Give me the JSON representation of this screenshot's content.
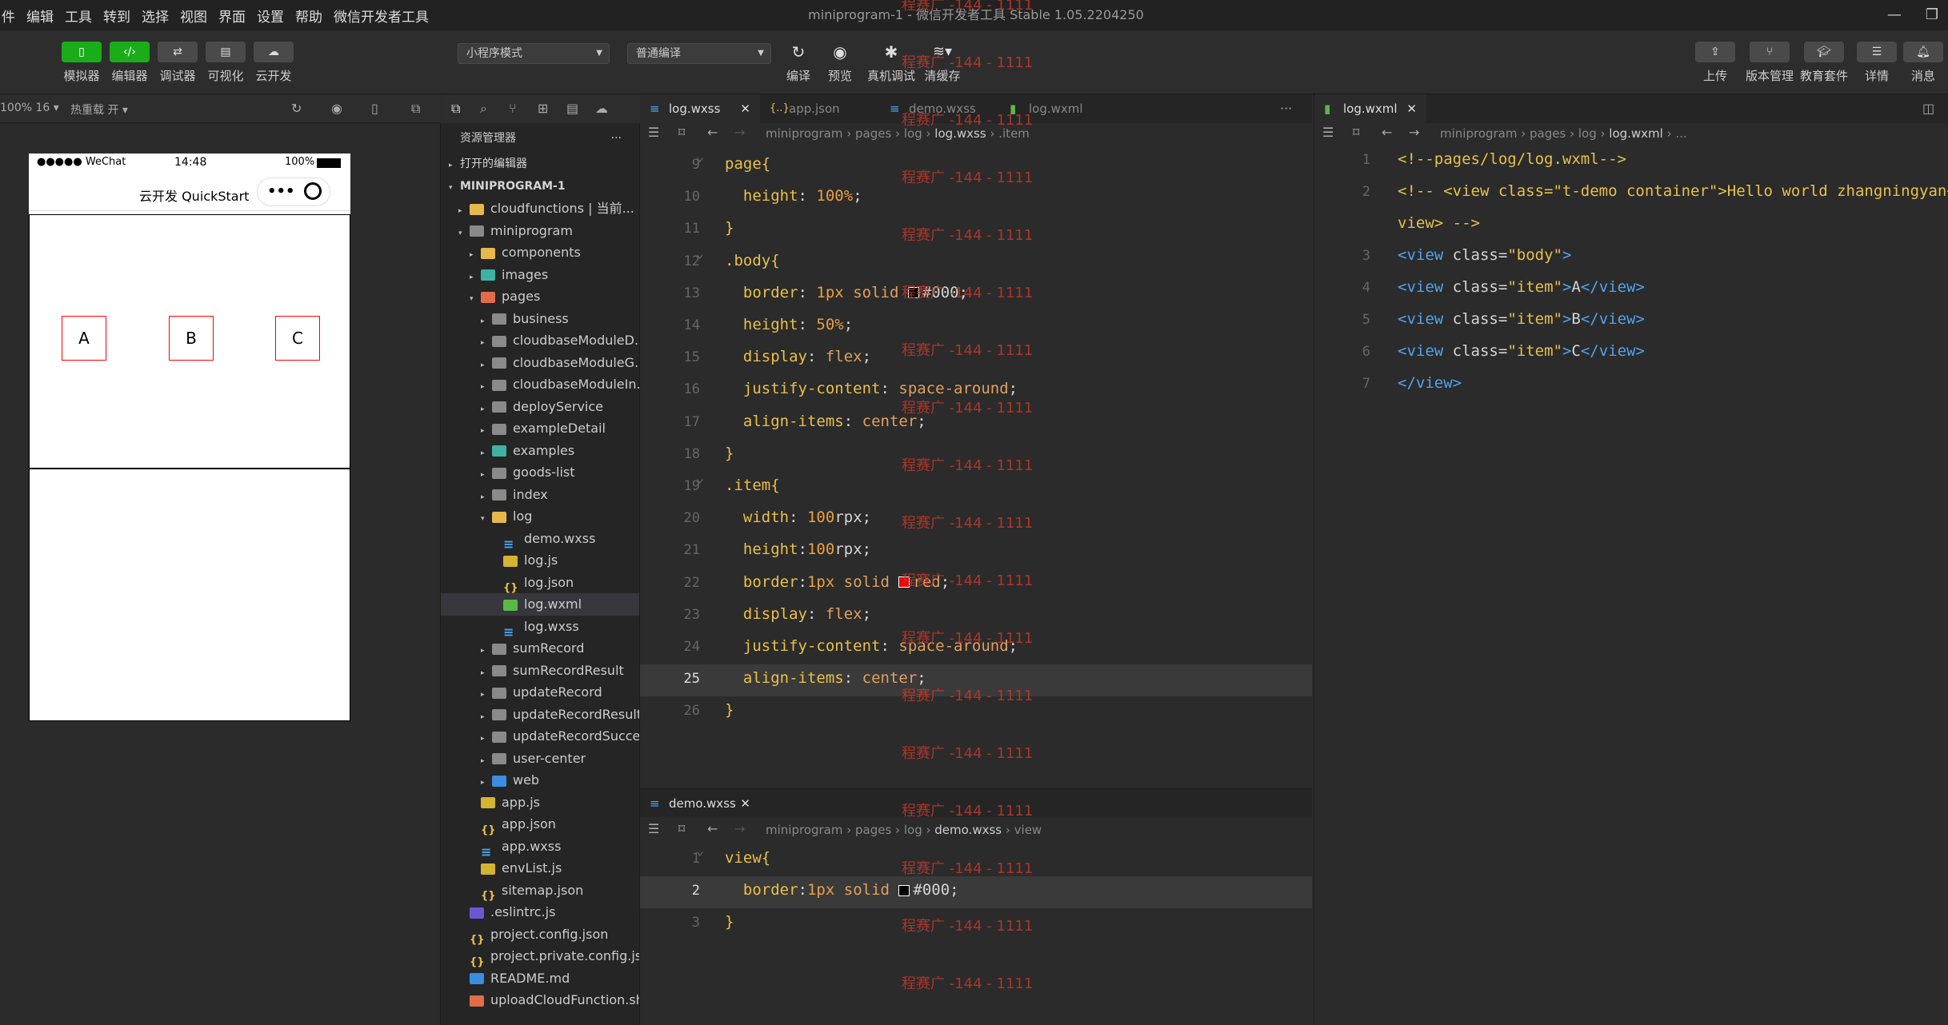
{
  "menu": [
    "件",
    "编辑",
    "工具",
    "转到",
    "选择",
    "视图",
    "界面",
    "设置",
    "帮助",
    "微信开发者工具"
  ],
  "window_title": "miniprogram-1 - 微信开发者工具 Stable 1.05.2204250",
  "toolbar": {
    "left": [
      "模拟器",
      "编辑器",
      "调试器",
      "可视化",
      "云开发"
    ],
    "mode_select": "小程序模式",
    "compile_select": "普通编译",
    "mid": [
      "编译",
      "预览",
      "真机调试",
      "清缓存"
    ],
    "right": [
      "上传",
      "版本管理",
      "教育套件",
      "详情",
      "消息"
    ]
  },
  "simbar": {
    "zoom": "100% 16 ▾",
    "hotreload": "热重载 开 ▾"
  },
  "phone": {
    "carrier": "●●●●● WeChat",
    "time": "14:48",
    "battery": "100%",
    "title": "云开发 QuickStart",
    "items": [
      "A",
      "B",
      "C"
    ]
  },
  "explorer": {
    "title": "资源管理器",
    "sections": [
      "打开的编辑器",
      "MINIPROGRAM-1"
    ],
    "tree": [
      {
        "label": "cloudfunctions | 当前...",
        "depth": 1,
        "icon": "fold-y",
        "car": "▸"
      },
      {
        "label": "miniprogram",
        "depth": 1,
        "icon": "fold",
        "car": "▾"
      },
      {
        "label": "components",
        "depth": 2,
        "icon": "fold-y",
        "car": "▸"
      },
      {
        "label": "images",
        "depth": 2,
        "icon": "fold-t",
        "car": "▸"
      },
      {
        "label": "pages",
        "depth": 2,
        "icon": "fold-r",
        "car": "▾"
      },
      {
        "label": "business",
        "depth": 3,
        "icon": "fold",
        "car": "▸"
      },
      {
        "label": "cloudbaseModuleD...",
        "depth": 3,
        "icon": "fold",
        "car": "▸"
      },
      {
        "label": "cloudbaseModuleG...",
        "depth": 3,
        "icon": "fold",
        "car": "▸"
      },
      {
        "label": "cloudbaseModuleIn...",
        "depth": 3,
        "icon": "fold",
        "car": "▸"
      },
      {
        "label": "deployService",
        "depth": 3,
        "icon": "fold",
        "car": "▸"
      },
      {
        "label": "exampleDetail",
        "depth": 3,
        "icon": "fold",
        "car": "▸"
      },
      {
        "label": "examples",
        "depth": 3,
        "icon": "fold-t",
        "car": "▸"
      },
      {
        "label": "goods-list",
        "depth": 3,
        "icon": "fold",
        "car": "▸"
      },
      {
        "label": "index",
        "depth": 3,
        "icon": "fold",
        "car": "▸"
      },
      {
        "label": "log",
        "depth": 3,
        "icon": "fold-y",
        "car": "▾"
      },
      {
        "label": "demo.wxss",
        "depth": 4,
        "icon": "css",
        "car": ""
      },
      {
        "label": "log.js",
        "depth": 4,
        "icon": "js",
        "car": ""
      },
      {
        "label": "log.json",
        "depth": 4,
        "icon": "json",
        "car": ""
      },
      {
        "label": "log.wxml",
        "depth": 4,
        "icon": "wxml",
        "car": "",
        "selected": true
      },
      {
        "label": "log.wxss",
        "depth": 4,
        "icon": "css",
        "car": ""
      },
      {
        "label": "sumRecord",
        "depth": 3,
        "icon": "fold",
        "car": "▸"
      },
      {
        "label": "sumRecordResult",
        "depth": 3,
        "icon": "fold",
        "car": "▸"
      },
      {
        "label": "updateRecord",
        "depth": 3,
        "icon": "fold",
        "car": "▸"
      },
      {
        "label": "updateRecordResult",
        "depth": 3,
        "icon": "fold",
        "car": "▸"
      },
      {
        "label": "updateRecordSuccess",
        "depth": 3,
        "icon": "fold",
        "car": "▸"
      },
      {
        "label": "user-center",
        "depth": 3,
        "icon": "fold",
        "car": "▸"
      },
      {
        "label": "web",
        "depth": 3,
        "icon": "fold-b",
        "car": "▸"
      },
      {
        "label": "app.js",
        "depth": 2,
        "icon": "js",
        "car": ""
      },
      {
        "label": "app.json",
        "depth": 2,
        "icon": "json",
        "car": ""
      },
      {
        "label": "app.wxss",
        "depth": 2,
        "icon": "css",
        "car": ""
      },
      {
        "label": "envList.js",
        "depth": 2,
        "icon": "js",
        "car": ""
      },
      {
        "label": "sitemap.json",
        "depth": 2,
        "icon": "json",
        "car": ""
      },
      {
        "label": ".eslintrc.js",
        "depth": 1,
        "icon": "esl",
        "car": ""
      },
      {
        "label": "project.config.json",
        "depth": 1,
        "icon": "json",
        "car": ""
      },
      {
        "label": "project.private.config.js...",
        "depth": 1,
        "icon": "json",
        "car": ""
      },
      {
        "label": "README.md",
        "depth": 1,
        "icon": "md",
        "car": ""
      },
      {
        "label": "uploadCloudFunction.sh",
        "depth": 1,
        "icon": "sh",
        "car": ""
      }
    ]
  },
  "tabs1": [
    "log.wxss",
    "app.json",
    "demo.wxss",
    "log.wxml"
  ],
  "crumb1": [
    "miniprogram",
    "pages",
    "log",
    "log.wxss",
    ".item"
  ],
  "editor1_lines": [
    {
      "n": "9",
      "html": "<span class='k'>page</span><span class='br'>{</span>"
    },
    {
      "n": "10",
      "html": "  <span class='k'>height</span>: <span class='v'>100%</span>;"
    },
    {
      "n": "11",
      "html": "<span class='br'>}</span>"
    },
    {
      "n": "12",
      "html": "<span class='k'>.body</span><span class='br'>{</span>"
    },
    {
      "n": "13",
      "html": "  <span class='k'>border</span>: <span class='v'>1px</span> <span class='s'>solid</span> SW0#000;"
    },
    {
      "n": "14",
      "html": "  <span class='k'>height</span>: <span class='v'>50%</span>;"
    },
    {
      "n": "15",
      "html": "  <span class='k'>display</span>: <span class='s'>flex</span>;"
    },
    {
      "n": "16",
      "html": "  <span class='k'>justify-content</span>: <span class='s'>space-around</span>;"
    },
    {
      "n": "17",
      "html": "  <span class='k'>align-items</span>: <span class='s'>center</span>;"
    },
    {
      "n": "18",
      "html": "<span class='br'>}</span>"
    },
    {
      "n": "19",
      "html": "<span class='k'>.item</span><span class='br'>{</span>"
    },
    {
      "n": "20",
      "html": "  <span class='k'>width</span>: <span class='v'>100</span>rpx;"
    },
    {
      "n": "21",
      "html": "  <span class='k'>height</span>:<span class='v'>100</span>rpx;"
    },
    {
      "n": "22",
      "html": "  <span class='k'>border</span>:<span class='v'>1px</span> <span class='s'>solid</span> SW1<span class='s'>red</span>;"
    },
    {
      "n": "23",
      "html": "  <span class='k'>display</span>: <span class='s'>flex</span>;"
    },
    {
      "n": "24",
      "html": "  <span class='k'>justify-content</span>: <span class='s'>space-around</span>;"
    },
    {
      "n": "25",
      "html": "  <span class='k'>align-items</span>: <span class='s'>center</span>;"
    },
    {
      "n": "26",
      "html": "<span class='br'>}</span>"
    }
  ],
  "editor2": {
    "tab": "demo.wxss",
    "crumb": [
      "miniprogram",
      "pages",
      "log",
      "demo.wxss",
      "view"
    ],
    "lines": [
      {
        "n": "1",
        "html": "<span class='k'>view</span><span class='br'>{</span>"
      },
      {
        "n": "2",
        "html": "  <span class='k'>border</span>:<span class='v'>1px</span> <span class='s'>solid</span> SW0#000;"
      },
      {
        "n": "3",
        "html": "<span class='br'>}</span>"
      }
    ]
  },
  "right": {
    "tab": "log.wxml",
    "crumb": [
      "miniprogram",
      "pages",
      "log",
      "log.wxml",
      "..."
    ],
    "lines": [
      {
        "n": "1",
        "html": "<span class='cm'>&lt;!--pages/log/log.wxml--&gt;</span>"
      },
      {
        "n": "2",
        "html": "<span class='cm'>&lt;!-- &lt;view class=\"t-demo container\"&gt;Hello world zhangningyan&lt;/</span>"
      },
      {
        "n": "",
        "html": "<span class='cm'>view&gt; --&gt;</span>"
      },
      {
        "n": "3",
        "html": "<span class='tg'>&lt;view</span> <span class='at'>class</span>=<span class='st'>\"body\"</span><span class='tg'>&gt;</span>"
      },
      {
        "n": "4",
        "html": "<span class='tg'>&lt;view</span> <span class='at'>class</span>=<span class='st'>\"item\"</span><span class='tg'>&gt;</span>A<span class='tg'>&lt;/view&gt;</span>"
      },
      {
        "n": "5",
        "html": "<span class='tg'>&lt;view</span> <span class='at'>class</span>=<span class='st'>\"item\"</span><span class='tg'>&gt;</span>B<span class='tg'>&lt;/view&gt;</span>"
      },
      {
        "n": "6",
        "html": "<span class='tg'>&lt;view</span> <span class='at'>class</span>=<span class='st'>\"item\"</span><span class='tg'>&gt;</span>C<span class='tg'>&lt;/view&gt;</span>"
      },
      {
        "n": "7",
        "html": "<span class='tg'>&lt;/view&gt;</span>"
      }
    ]
  },
  "watermark": "程赛广 -144 - 1111"
}
